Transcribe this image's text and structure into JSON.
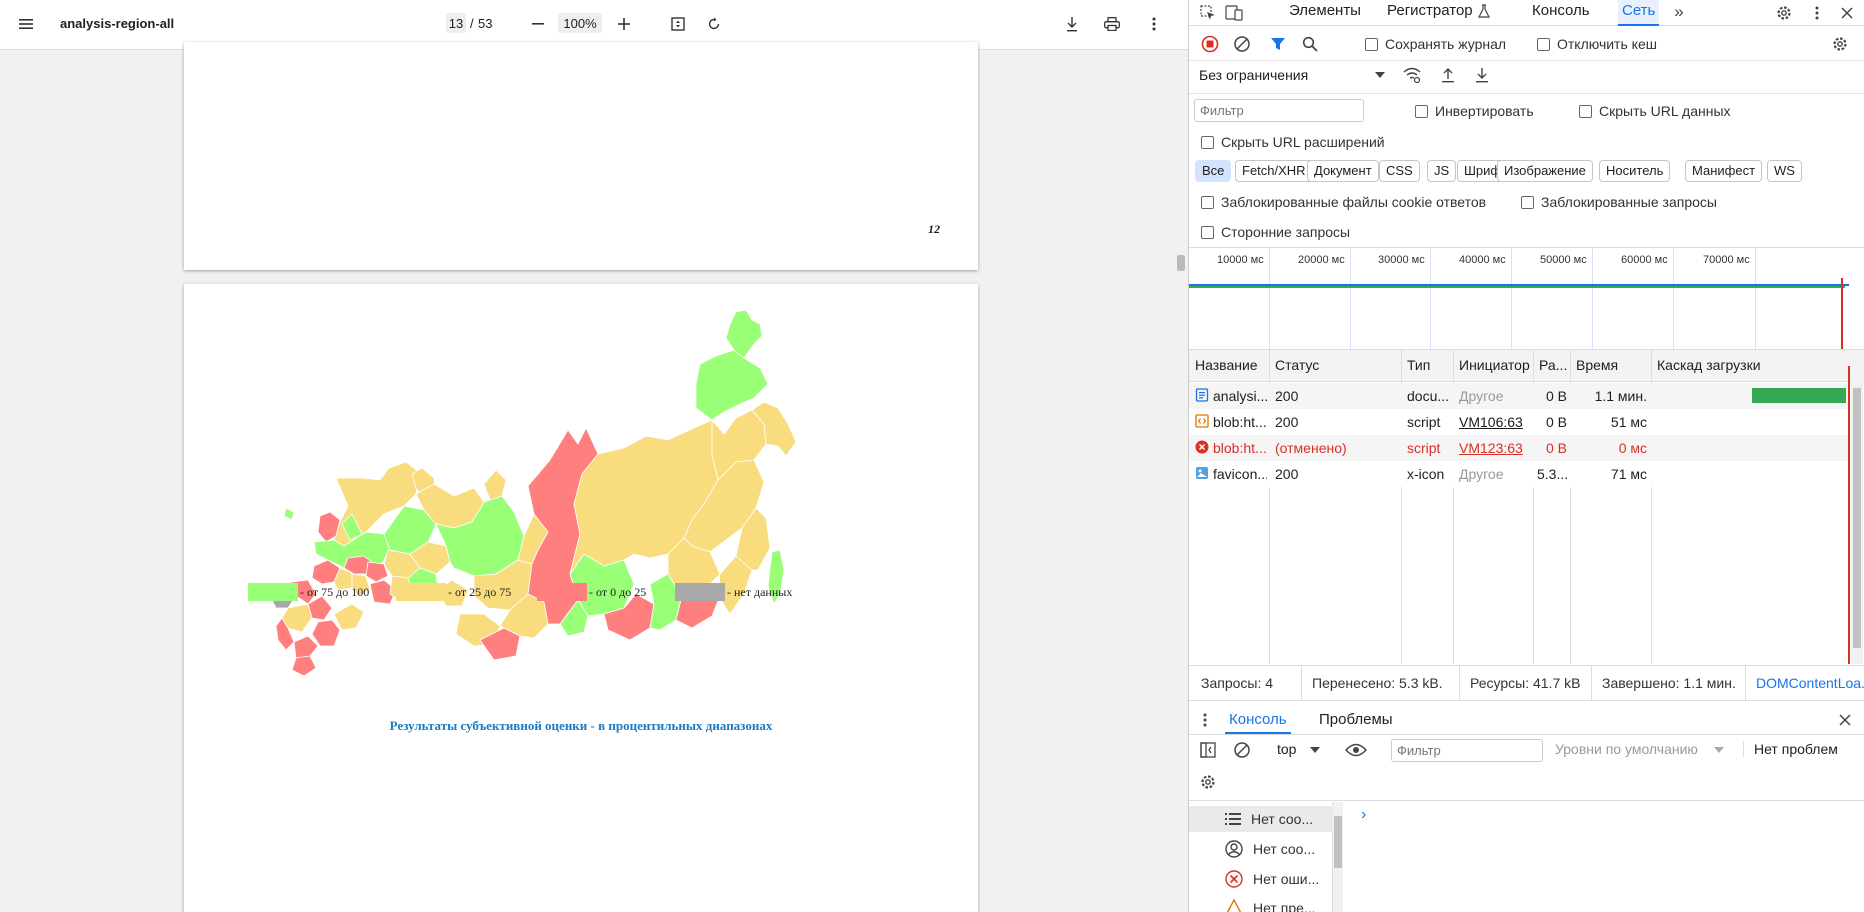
{
  "pdf": {
    "title": "analysis-region-all",
    "page_current": "13",
    "page_separator": "/",
    "page_total": "53",
    "zoom": "100%"
  },
  "page1": {
    "page_number": "12"
  },
  "map": {
    "legend": [
      {
        "label": "- от 75 до 100",
        "color": "#99ff77"
      },
      {
        "label": "- от 25 до 75",
        "color": "#f8dc7e"
      },
      {
        "label": "- от 0 до 25",
        "color": "#ff7f7f"
      },
      {
        "label": "- нет данных",
        "color": "#a9a9a9"
      }
    ],
    "caption": "Результаты субъективной оценки - в процентильных диапазонах"
  },
  "devtools": {
    "tabs": [
      "Элементы",
      "Регистратор",
      "Консоль",
      "Сеть"
    ],
    "active_tab": "Сеть",
    "preserve_log": "Сохранять журнал",
    "disable_cache": "Отключить кеш",
    "throttling": "Без ограничения",
    "filter_placeholder": "Фильтр",
    "invert": "Инвертировать",
    "hide_data_urls": "Скрыть URL данных",
    "hide_ext_urls": "Скрыть URL расширений",
    "type_filters": [
      "Все",
      "Fetch/XHR",
      "Документ",
      "CSS",
      "JS",
      "Шрифт",
      "Изображение",
      "Носитель",
      "Манифест",
      "WS"
    ],
    "blocked_cookies": "Заблокированные файлы cookie ответов",
    "blocked_requests": "Заблокированные запросы",
    "third_party": "Сторонние запросы",
    "timeline_ticks": [
      "10000 мс",
      "20000 мс",
      "30000 мс",
      "40000 мс",
      "50000 мс",
      "60000 мс",
      "70000 мс"
    ],
    "columns": [
      "Название",
      "Статус",
      "Тип",
      "Инициатор",
      "Ра...",
      "Время",
      "Каскад загрузки"
    ],
    "rows": [
      {
        "name": "analysi...",
        "status": "200",
        "type": "docu...",
        "initiator": "Другое",
        "size": "0 B",
        "time": "1.1 мин.",
        "icon": "document-icon",
        "error": false
      },
      {
        "name": "blob:ht...",
        "status": "200",
        "type": "script",
        "initiator": "VM106:63",
        "size": "0 B",
        "time": "51 мс",
        "icon": "script-icon",
        "error": false
      },
      {
        "name": "blob:ht...",
        "status": "(отменено)",
        "type": "script",
        "initiator": "VM123:63",
        "size": "0 B",
        "time": "0 мс",
        "icon": "error-icon",
        "error": true
      },
      {
        "name": "favicon....",
        "status": "200",
        "type": "x-icon",
        "initiator": "Другое",
        "size": "5.3...",
        "time": "71 мс",
        "icon": "image-icon",
        "error": false
      }
    ],
    "summary": {
      "requests": "Запросы: 4",
      "transferred": "Перенесено: 5.3 kB.",
      "resources": "Ресурсы: 41.7 kB",
      "finished": "Завершено: 1.1 мин.",
      "dcl": "DOMContentLoa..."
    },
    "drawer_tabs": [
      "Консоль",
      "Проблемы"
    ],
    "console_context": "top",
    "console_filter_placeholder": "Фильтр",
    "levels": "Уровни по умолчанию",
    "no_issues": "Нет проблем",
    "sidebar": [
      "Нет соо...",
      "Нет соо...",
      "Нет оши...",
      "Нет пре..."
    ],
    "prompt": "›"
  }
}
